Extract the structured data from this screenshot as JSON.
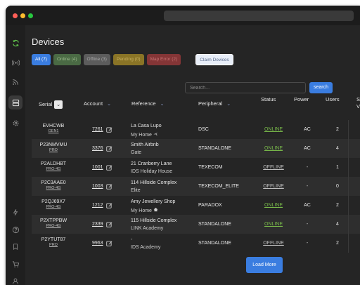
{
  "page": {
    "title": "Devices"
  },
  "filters": [
    {
      "label": "All (7)",
      "kind": "all"
    },
    {
      "label": "Online (4)",
      "kind": "online"
    },
    {
      "label": "Offline (3)",
      "kind": "offline"
    },
    {
      "label": "Pending (0)",
      "kind": "pending"
    },
    {
      "label": "Map Error (2)",
      "kind": "maperror"
    }
  ],
  "claim_button": "Claim Devices",
  "search": {
    "placeholder": "Search...",
    "button": "search"
  },
  "table": {
    "headers": {
      "serial": "Serial",
      "account": "Account",
      "reference": "Reference",
      "peripheral": "Peripheral",
      "status": "Status",
      "power": "Power",
      "users": "Users",
      "extra": "S\nV"
    },
    "rows": [
      {
        "serial": "EVHCWB",
        "model": "GEN1",
        "account": "7261",
        "ref1": "La Casa Lupo",
        "ref2": "My Home",
        "ref2_icon": "plane-icon",
        "peripheral": "DSC",
        "status": "ONLINE",
        "power": "AC",
        "users": "2"
      },
      {
        "serial": "P23NMVMU",
        "model": "PRO",
        "account": "3376",
        "ref1": "Smith Airbnb",
        "ref2": "Gate",
        "ref2_icon": "",
        "peripheral": "STANDALONE",
        "status": "ONLINE",
        "power": "AC",
        "users": "4"
      },
      {
        "serial": "P2ALDHBT",
        "model": "PRO-4G",
        "account": "1001",
        "ref1": "21 Cranberry Lane",
        "ref2": "IDS Holiday House",
        "ref2_icon": "",
        "peripheral": "TEXECOM",
        "status": "OFFLINE",
        "power": "-",
        "users": "1"
      },
      {
        "serial": "P2C3AAE0",
        "model": "PRO-4G",
        "account": "1003",
        "ref1": "114 Hillside Complex",
        "ref2": "Elite",
        "ref2_icon": "",
        "peripheral": "TEXECOM_ELITE",
        "status": "OFFLINE",
        "power": "-",
        "users": "0"
      },
      {
        "serial": "P2QJ69X7",
        "model": "PRO-4G",
        "account": "1212",
        "ref1": "Amy Jewellery Shop",
        "ref2": "My Home",
        "ref2_icon": "house-icon",
        "peripheral": "PARADOX",
        "status": "ONLINE",
        "power": "AC",
        "users": "2"
      },
      {
        "serial": "P2XTPPBW",
        "model": "PRO-4G",
        "account": "2339",
        "ref1": "115 Hillside Complex",
        "ref2": "LINK Academy",
        "ref2_icon": "",
        "peripheral": "STANDALONE",
        "status": "ONLINE",
        "power": "-",
        "users": "4"
      },
      {
        "serial": "P2YTUT87",
        "model": "PRO",
        "account": "9963",
        "ref1": "-",
        "ref2": "IDS Academy",
        "ref2_icon": "",
        "peripheral": "STANDALONE",
        "status": "OFFLINE",
        "power": "-",
        "users": "2"
      }
    ]
  },
  "load_more": "Load More",
  "colors": {
    "accent": "#3a7de0",
    "online": "#78b84a",
    "offline": "#bdbdbd",
    "sidebar_active": "#5fbf4a"
  },
  "sidebar_icons": [
    "refresh-icon",
    "broadcast-icon",
    "rss-icon",
    "devices-icon",
    "settings-icon",
    "bolt-icon",
    "help-icon",
    "bookmark-icon",
    "cart-icon",
    "user-icon"
  ]
}
